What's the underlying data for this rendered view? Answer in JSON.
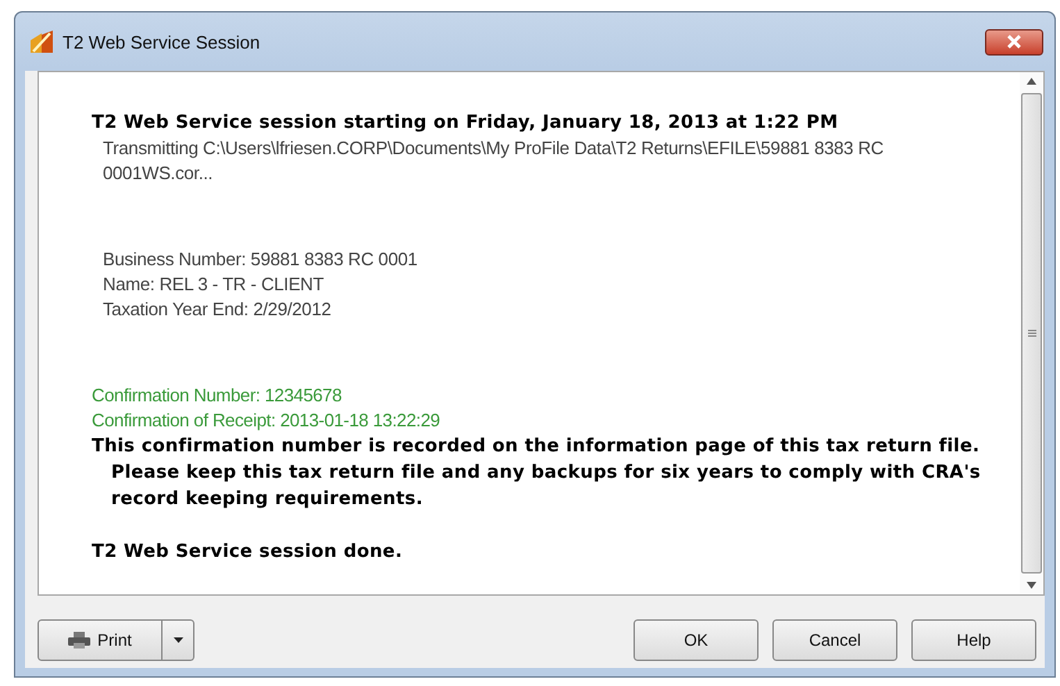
{
  "window": {
    "title": "T2 Web Service Session"
  },
  "log": [
    {
      "kind": "heading",
      "text": "T2 Web Service session starting on Friday, January 18, 2013 at 1:22 PM"
    },
    {
      "kind": "detail",
      "text": "Transmitting C:\\Users\\lfriesen.CORP\\Documents\\My ProFile Data\\T2 Returns\\EFILE\\59881 8383 RC 0001WS.cor..."
    },
    {
      "kind": "gap"
    },
    {
      "kind": "detail",
      "text": "Business Number: 59881 8383 RC 0001"
    },
    {
      "kind": "detail",
      "text": "Name: REL 3 - TR - CLIENT"
    },
    {
      "kind": "detail",
      "text": "Taxation Year End: 2/29/2012"
    },
    {
      "kind": "gap"
    },
    {
      "kind": "success",
      "text": "Confirmation Number: 12345678"
    },
    {
      "kind": "success",
      "text": "Confirmation of Receipt: 2013-01-18 13:22:29"
    },
    {
      "kind": "note",
      "text": "This confirmation number is recorded on the information page of this tax return file. Please keep this tax return file and any backups for six years to comply with CRA's record keeping requirements."
    },
    {
      "kind": "small-gap"
    },
    {
      "kind": "heading",
      "text": "T2 Web Service session done."
    }
  ],
  "buttons": {
    "print": "Print",
    "ok": "OK",
    "cancel": "Cancel",
    "help": "Help"
  }
}
